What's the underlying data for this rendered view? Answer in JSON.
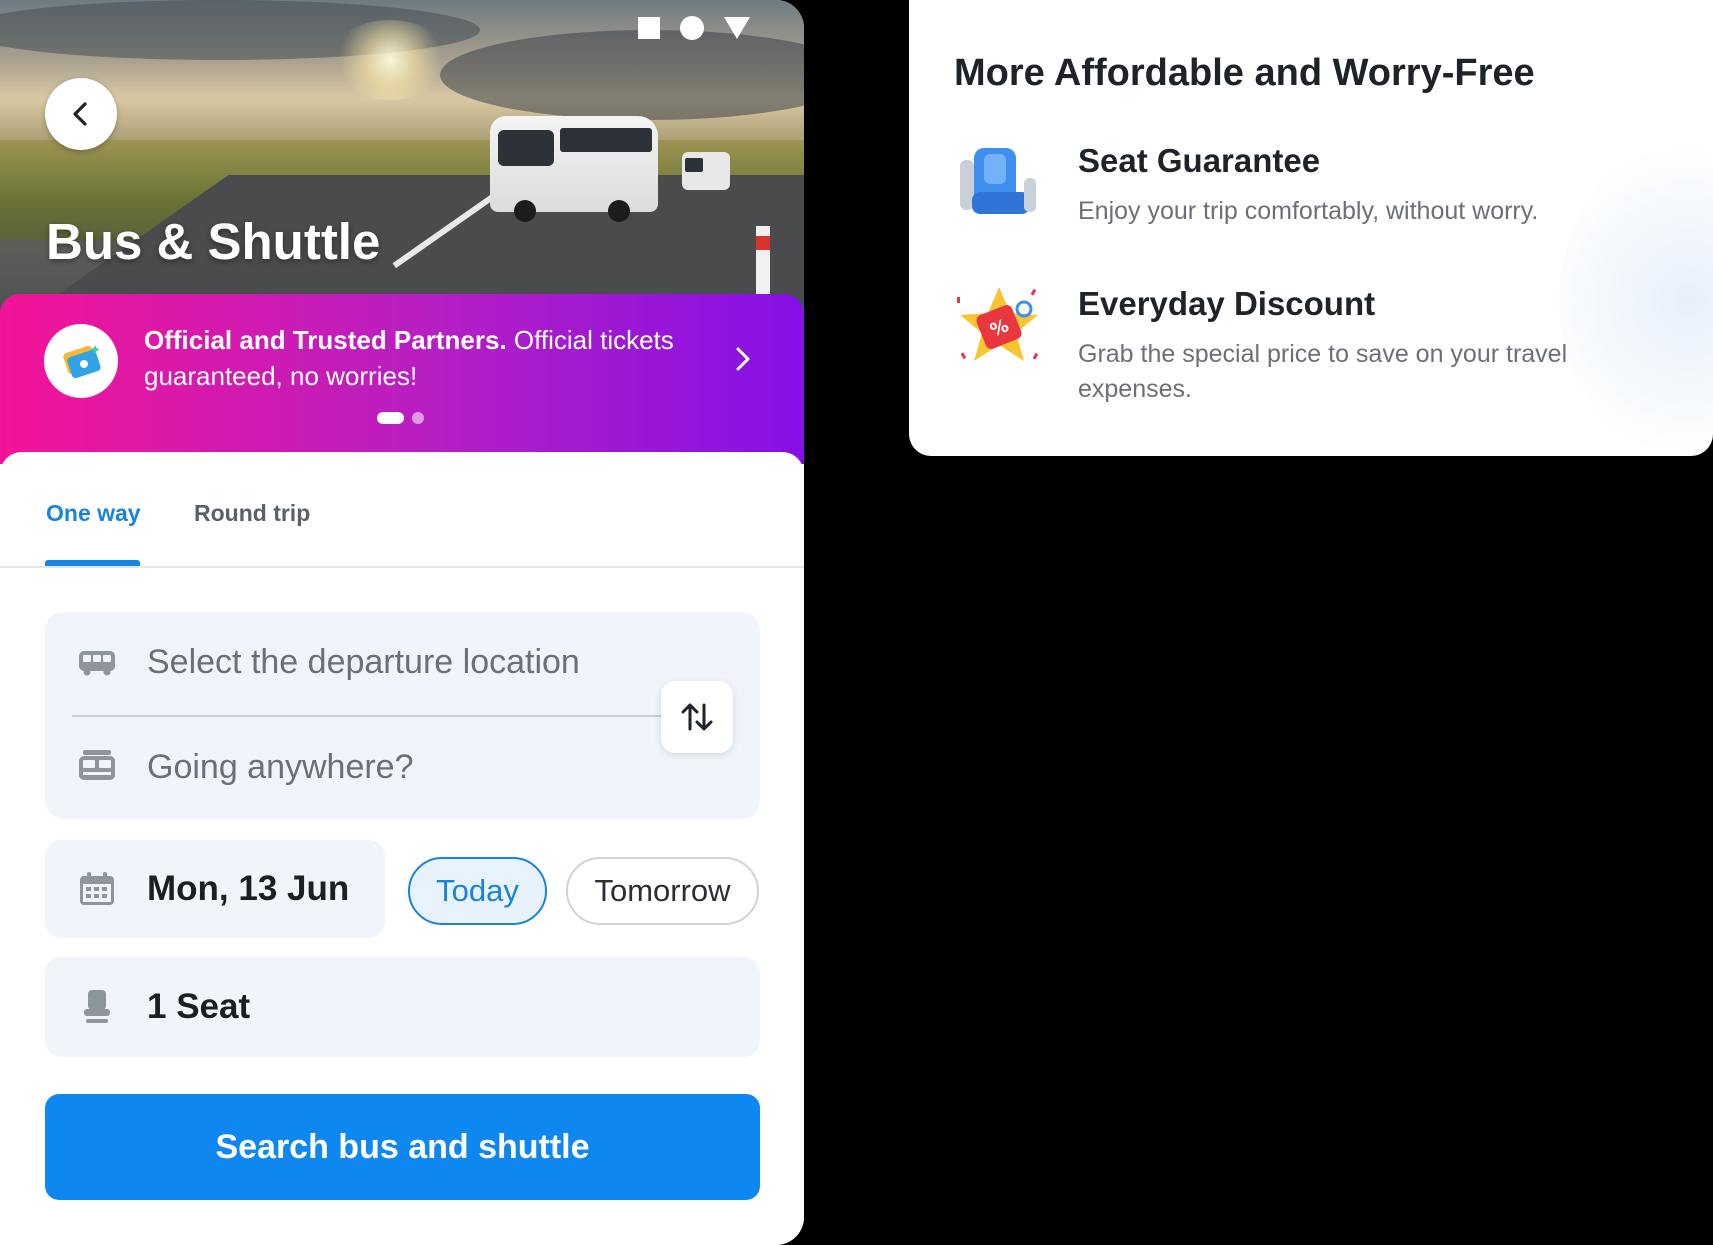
{
  "hero": {
    "title": "Bus & Shuttle"
  },
  "banner": {
    "bold_text": "Official and Trusted Partners.",
    "text": " Official tickets guaranteed, no worries!"
  },
  "tabs": [
    {
      "label": "One way",
      "active": true
    },
    {
      "label": "Round trip",
      "active": false
    }
  ],
  "form": {
    "departure_placeholder": "Select the departure location",
    "destination_placeholder": "Going anywhere?",
    "date_value": "Mon, 13 Jun",
    "chip_today": "Today",
    "chip_tomorrow": "Tomorrow",
    "seats_value": "1 Seat",
    "search_label": "Search bus and shuttle"
  },
  "info": {
    "title": "More Affordable and Worry-Free",
    "features": [
      {
        "title": "Seat Guarantee",
        "desc": "Enjoy your trip comfortably, without worry.",
        "icon": "seat-icon"
      },
      {
        "title": "Everyday Discount",
        "desc": "Grab the special price to save on your travel expenses.",
        "icon": "discount-tag-icon"
      }
    ]
  },
  "colors": {
    "accent": "#1a83dd",
    "search_button": "#0f87f0",
    "banner_start": "#f31498",
    "banner_end": "#8510e6"
  }
}
